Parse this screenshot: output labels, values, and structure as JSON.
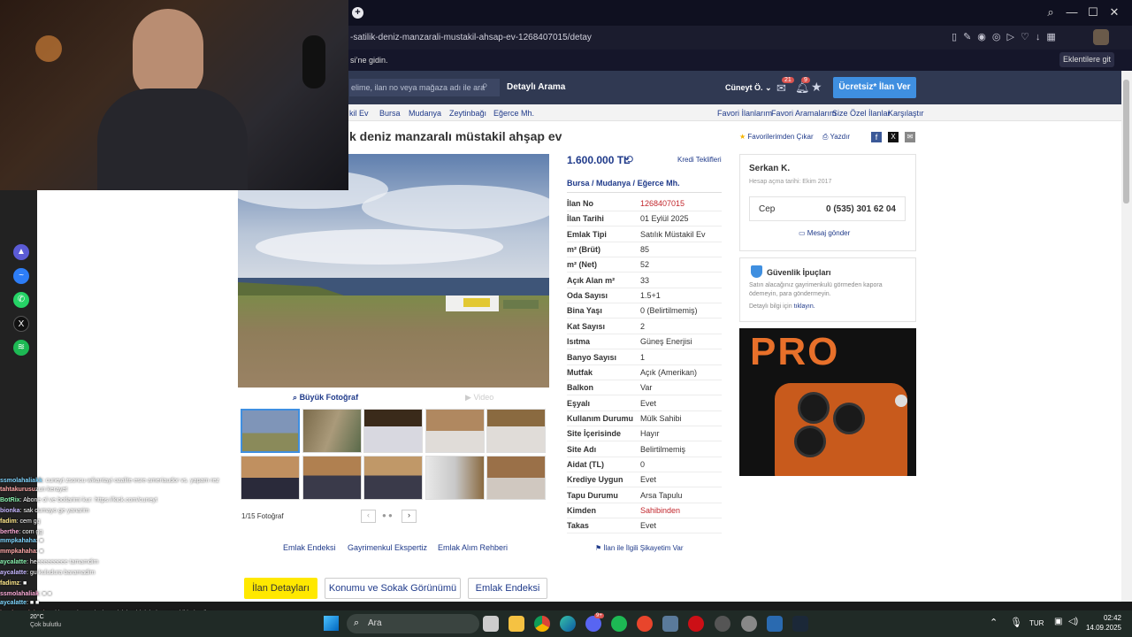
{
  "browser": {
    "url": "-satilik-deniz-manzarali-mustakil-ahsap-ev-1268407015/detay",
    "info_text": "si’ne gidin.",
    "extensions_button": "Eklentilere git"
  },
  "header": {
    "search_placeholder": "elime, ilan no veya mağaza adı ile ara",
    "detailed_search": "Detaylı Arama",
    "user_name": "Cüneyt Ö.",
    "message_badge": "21",
    "notif_badge": "9",
    "post_ad_button": "Ücretsiz* İlan Ver"
  },
  "breadcrumb": {
    "items": [
      "kil Ev",
      "Bursa",
      "Mudanya",
      "Zeytinbağı",
      "Eğerce Mh."
    ],
    "links": [
      "Favori İlanlarım",
      "Favori Aramalarım",
      "Size Özel İlanlar",
      "Karşılaştır"
    ]
  },
  "listing": {
    "title": "k deniz manzaralı müstakil ahşap ev",
    "favorite_remove": "Favorilerimden Çıkar",
    "print": "Yazdır",
    "big_photo": "Büyük Fotoğraf",
    "video": "Video",
    "photo_counter": "1/15 Fotoğraf",
    "price": "1.600.000 TL",
    "credit_offers": "Kredi Teklifleri",
    "location": [
      "Bursa",
      "Mudanya",
      "Eğerce Mh."
    ],
    "details": [
      {
        "k": "İlan No",
        "v": "1268407015"
      },
      {
        "k": "İlan Tarihi",
        "v": "01 Eylül 2025"
      },
      {
        "k": "Emlak Tipi",
        "v": "Satılık Müstakil Ev"
      },
      {
        "k": "m² (Brüt)",
        "v": "85"
      },
      {
        "k": "m² (Net)",
        "v": "52"
      },
      {
        "k": "Açık Alan m²",
        "v": "33"
      },
      {
        "k": "Oda Sayısı",
        "v": "1.5+1"
      },
      {
        "k": "Bina Yaşı",
        "v": "0 (Belirtilmemiş)"
      },
      {
        "k": "Kat Sayısı",
        "v": "2"
      },
      {
        "k": "Isıtma",
        "v": "Güneş Enerjisi"
      },
      {
        "k": "Banyo Sayısı",
        "v": "1"
      },
      {
        "k": "Mutfak",
        "v": "Açık (Amerikan)"
      },
      {
        "k": "Balkon",
        "v": "Var"
      },
      {
        "k": "Eşyalı",
        "v": "Evet"
      },
      {
        "k": "Kullanım Durumu",
        "v": "Mülk Sahibi"
      },
      {
        "k": "Site İçerisinde",
        "v": "Hayır"
      },
      {
        "k": "Site Adı",
        "v": "Belirtilmemiş"
      },
      {
        "k": "Aidat (TL)",
        "v": "0"
      },
      {
        "k": "Krediye Uygun",
        "v": "Evet"
      },
      {
        "k": "Tapu Durumu",
        "v": "Arsa Tapulu"
      },
      {
        "k": "Kimden",
        "v": "Sahibinden"
      },
      {
        "k": "Takas",
        "v": "Evet"
      }
    ],
    "id_color": "#c2272d",
    "complaint": "İlan ile İlgili Şikayetim Var",
    "footer_links": [
      "Emlak Endeksi",
      "Gayrimenkul Ekspertiz",
      "Emlak Alım Rehberi"
    ],
    "tabs": [
      "İlan Detayları",
      "Konumu ve Sokak Görünümü",
      "Emlak Endeksi"
    ]
  },
  "seller": {
    "name": "Serkan K.",
    "since": "Hesap açma tarihi: Ekim 2017",
    "phone_label": "Cep",
    "phone": "0 (535) 301 62 04",
    "message": "Mesaj gönder"
  },
  "safety": {
    "title": "Güvenlik İpuçları",
    "text": "Satın alacağınız gayrimenkulü görmeden kapora ödemeyin, para göndermeyin.",
    "more_prefix": "Detaylı bilgi için",
    "more_link": "tıklayın."
  },
  "ad": {
    "text": "PRO"
  },
  "chat": [
    {
      "u": "ssmolahaliakk",
      "m": ": cuneyt zsoncu wikantayi ozalite esre ameriaudor vs. yapam rez"
    },
    {
      "u": "tahtakurusu",
      "m": "zun kerayet"
    },
    {
      "u": "BotRix",
      "m": ": Abone ol ve botlarimi kur: https://kick.com/cuneyt"
    },
    {
      "u": "bionka",
      "m": ": sak dumayo ge yanarim"
    },
    {
      "u": "fadim",
      "m": ": cem gg"
    },
    {
      "u": "berthe",
      "m": ": com gg"
    },
    {
      "u": "mmpkahaha",
      "m": ": ■"
    },
    {
      "u": "mmpkahaha",
      "m": ": ■"
    },
    {
      "u": "aycalatte",
      "m": ": heeeeeeeeee tamamdim"
    },
    {
      "u": "aycalatte",
      "m": ": gu kuludura baramadim"
    },
    {
      "u": "fadimz",
      "m": ": ■"
    },
    {
      "u": "ssmolahaliak",
      "m": ": ■ ■"
    },
    {
      "u": "aycalatte",
      "m": ": ■ ■"
    },
    {
      "u": "bertheandcharles",
      "m": ": kim ne derse desin en iyisi şehir içinde müstakil bahçeli ev"
    },
    {
      "u": "abi",
      "m": ""
    },
    {
      "u": "bionka",
      "m": ": batırsana şimdi"
    }
  ],
  "taskbar": {
    "weather_temp": "20°C",
    "weather_text": "Çok bulutlu",
    "search": "Ara",
    "lang": "TUR",
    "time": "02:42",
    "date": "14.09.2025",
    "notif_badge": "9+"
  },
  "colors": {
    "header_bg": "#303952",
    "link": "#1f3a8a",
    "accent_blue": "#3f8fe0",
    "tab_active": "#ffe800"
  }
}
